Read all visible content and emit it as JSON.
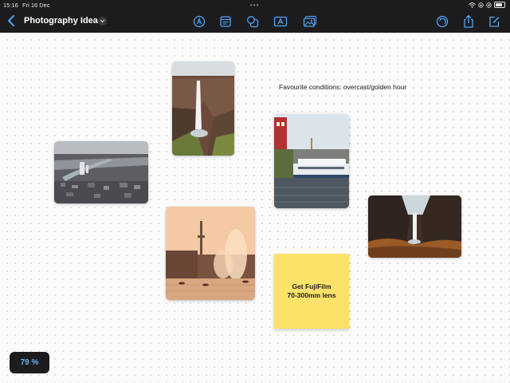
{
  "status_bar": {
    "time": "15:16",
    "date": "Fri 16 Dec",
    "icons": [
      "wifi-icon",
      "orientation-lock-icon",
      "location-icon",
      "battery-icon"
    ]
  },
  "header": {
    "title": "Photography Ideas",
    "left_icons": [
      "back-chevron-icon",
      "chevron-down-icon"
    ],
    "tools": [
      "pen-icon",
      "text-box-icon",
      "shapes-icon",
      "text-icon",
      "photo-icon"
    ],
    "right_icons": [
      "undo-icon",
      "share-icon",
      "compose-icon"
    ]
  },
  "canvas": {
    "text_note": "Favourite conditions: overcast/golden hour",
    "sticky_note": {
      "line1": "Get FujiFilm",
      "line2": "70-300mm lens"
    },
    "photos": [
      "waterfall-cliff-photo",
      "aerial-city-photo",
      "harbour-boat-photo",
      "fountain-golden-hour-photo",
      "waterfall-basalt-photo"
    ]
  },
  "zoom": "79 %",
  "colors": {
    "bar": "#1c1c1e",
    "accent": "#4fa3f7",
    "sticky": "#fde26a",
    "canvas": "#fbfbfb"
  }
}
